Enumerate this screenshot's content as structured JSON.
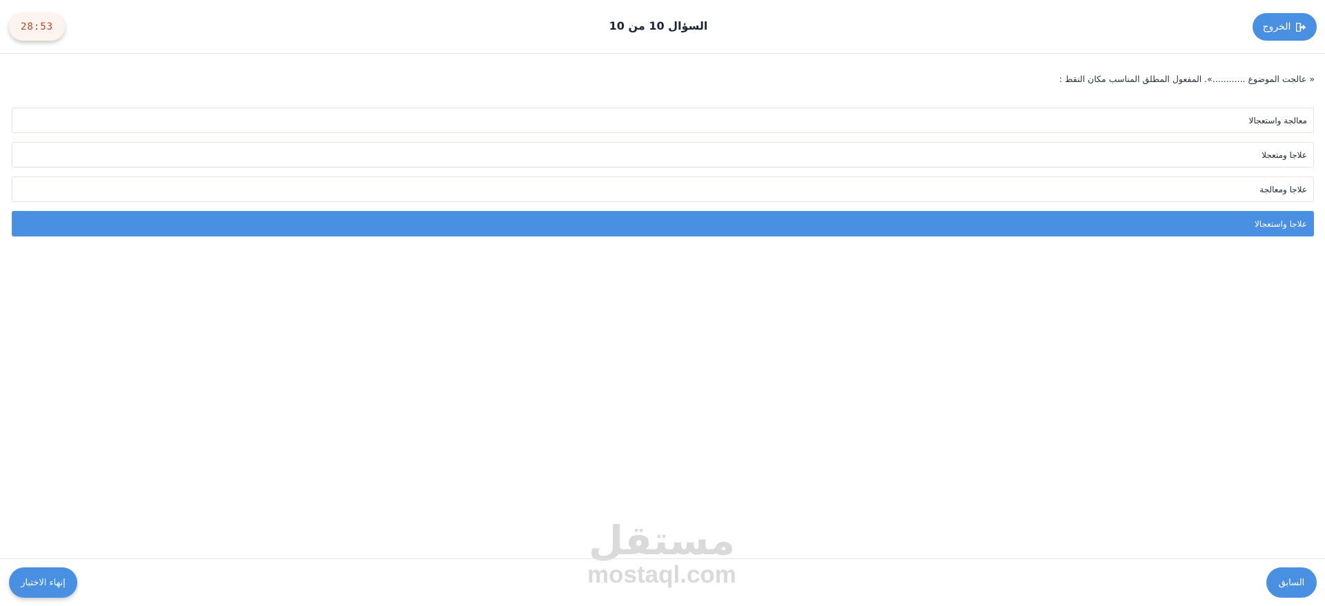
{
  "header": {
    "exit_label": "الخروج",
    "exit_icon": "sign-out-icon",
    "title": "السؤال 10 من 10",
    "timer": "28:53"
  },
  "question": {
    "text": "« عالجت الموضوع ............». المفعول المطلق المناسب مكان النقط :"
  },
  "options": [
    {
      "label": "معالجة واستعجالا",
      "selected": false
    },
    {
      "label": "علاجا ومتعجلا",
      "selected": false
    },
    {
      "label": "علاجا ومعالجة",
      "selected": false
    },
    {
      "label": "علاجا واستعجالا",
      "selected": true
    }
  ],
  "footer": {
    "prev_label": "السابق",
    "finish_label": "إنهاء الاختبار"
  },
  "watermark": {
    "arabic": "مستقل",
    "latin": "mostaql.com"
  },
  "colors": {
    "accent": "#4a90e2",
    "timer_text": "#c1442b",
    "timer_bg": "#fdf3ef",
    "border": "#dfe3e8"
  }
}
